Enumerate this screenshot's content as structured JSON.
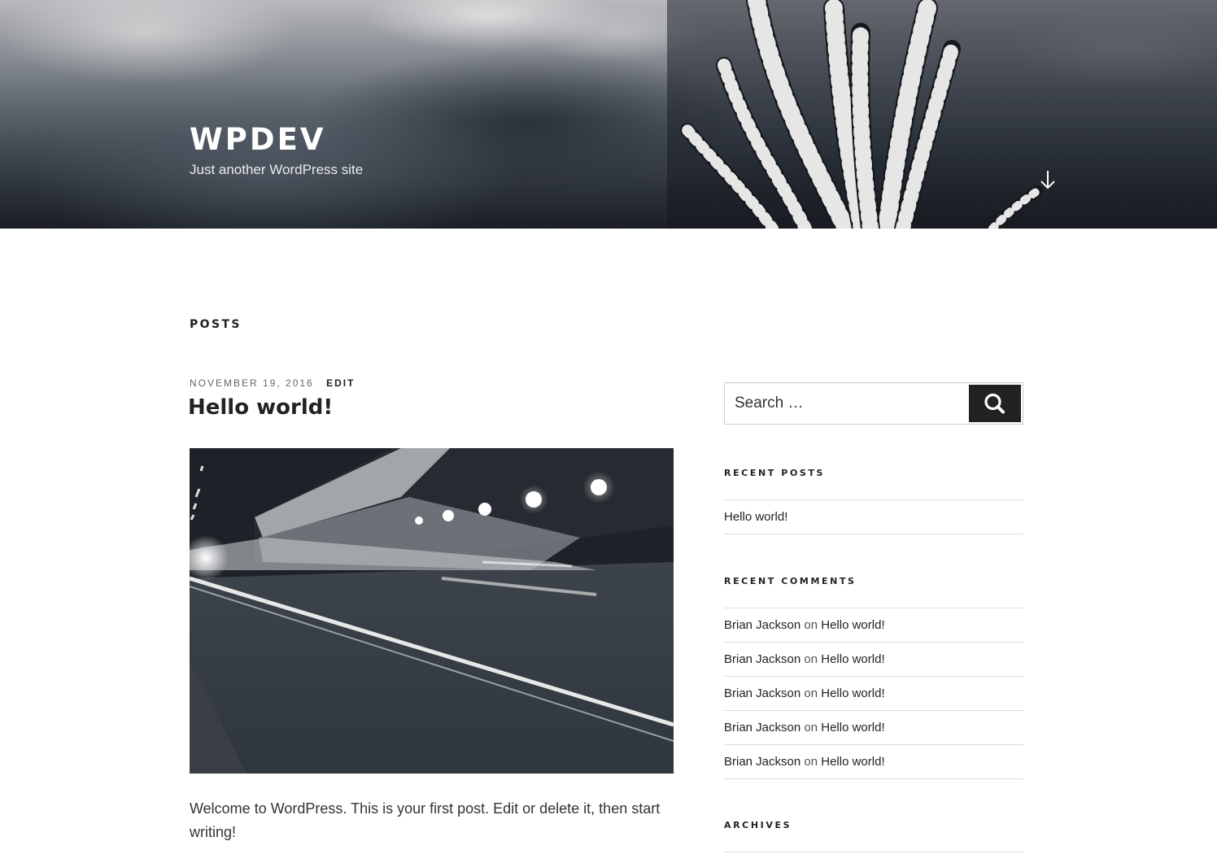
{
  "site": {
    "title": "WPDEV",
    "description": "Just another WordPress site"
  },
  "main": {
    "heading": "POSTS",
    "post": {
      "date": "NOVEMBER 19, 2016",
      "edit_label": "EDIT",
      "title": "Hello world!",
      "excerpt": "Welcome to WordPress. This is your first post. Edit or delete it, then start writing!"
    }
  },
  "sidebar": {
    "search": {
      "placeholder": "Search …"
    },
    "recent_posts": {
      "title": "RECENT POSTS",
      "items": [
        {
          "label": "Hello world!"
        }
      ]
    },
    "recent_comments": {
      "title": "RECENT COMMENTS",
      "connector": "on",
      "items": [
        {
          "author": "Brian Jackson",
          "post": "Hello world!"
        },
        {
          "author": "Brian Jackson",
          "post": "Hello world!"
        },
        {
          "author": "Brian Jackson",
          "post": "Hello world!"
        },
        {
          "author": "Brian Jackson",
          "post": "Hello world!"
        },
        {
          "author": "Brian Jackson",
          "post": "Hello world!"
        }
      ]
    },
    "archives": {
      "title": "ARCHIVES"
    }
  },
  "icons": {
    "scroll": "arrow-down-icon",
    "search": "search-icon"
  },
  "colors": {
    "text": "#222222",
    "button": "#222222",
    "rule": "#dddddd"
  }
}
